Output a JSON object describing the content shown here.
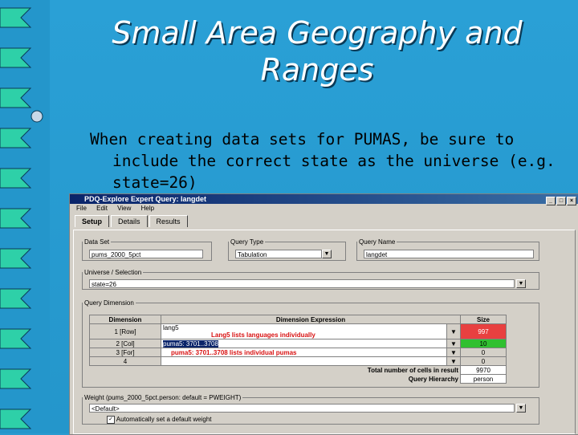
{
  "slide": {
    "title_line1": "Small Area Geography and",
    "title_line2": "Ranges",
    "body_line1": "When creating data sets for PUMAS, be sure to",
    "body_line2": "include the correct state as the universe (e.g.",
    "body_line3": "state=26)"
  },
  "window": {
    "title": "PDQ-Explore Expert Query: langdet",
    "menu": [
      "File",
      "Edit",
      "View",
      "Help"
    ],
    "tabs": [
      "Setup",
      "Details",
      "Results"
    ],
    "data_set_label": "Data Set",
    "data_set_value": "pums_2000_5pct",
    "query_type_label": "Query Type",
    "query_type_value": "Tabulation",
    "query_name_label": "Query Name",
    "query_name_value": "langdet",
    "universe_label": "Universe / Selection",
    "universe_value": "state=26",
    "query_dimension_label": "Query Dimension",
    "headers": {
      "dimension": "Dimension",
      "expression": "Dimension Expression",
      "size": "Size"
    },
    "rows": [
      {
        "dim": "1 [Row]",
        "expr": "lang5",
        "note": "Lang5 lists languages individually",
        "size": "997"
      },
      {
        "dim": "2 [Col]",
        "expr": "puma5: 3701..3708",
        "note": "",
        "size": "10"
      },
      {
        "dim": "3 [For]",
        "expr": "",
        "note": "puma5: 3701..3708 lists individual pumas",
        "size": "0"
      },
      {
        "dim": "4",
        "expr": "",
        "note": "",
        "size": "0"
      }
    ],
    "total_label": "Total number of cells in result",
    "total_value": "9970",
    "hierarchy_label": "Query Hierarchy",
    "hierarchy_value": "person",
    "weight_label": "Weight (pums_2000_5pct.person: default = PWEIGHT)",
    "weight_value": "<Default>",
    "auto_weight_label": "Automatically set a default weight"
  },
  "colors": {
    "accent": "#2496cb",
    "size_highlight_red": "#e84040",
    "size_highlight_green": "#30c030"
  }
}
